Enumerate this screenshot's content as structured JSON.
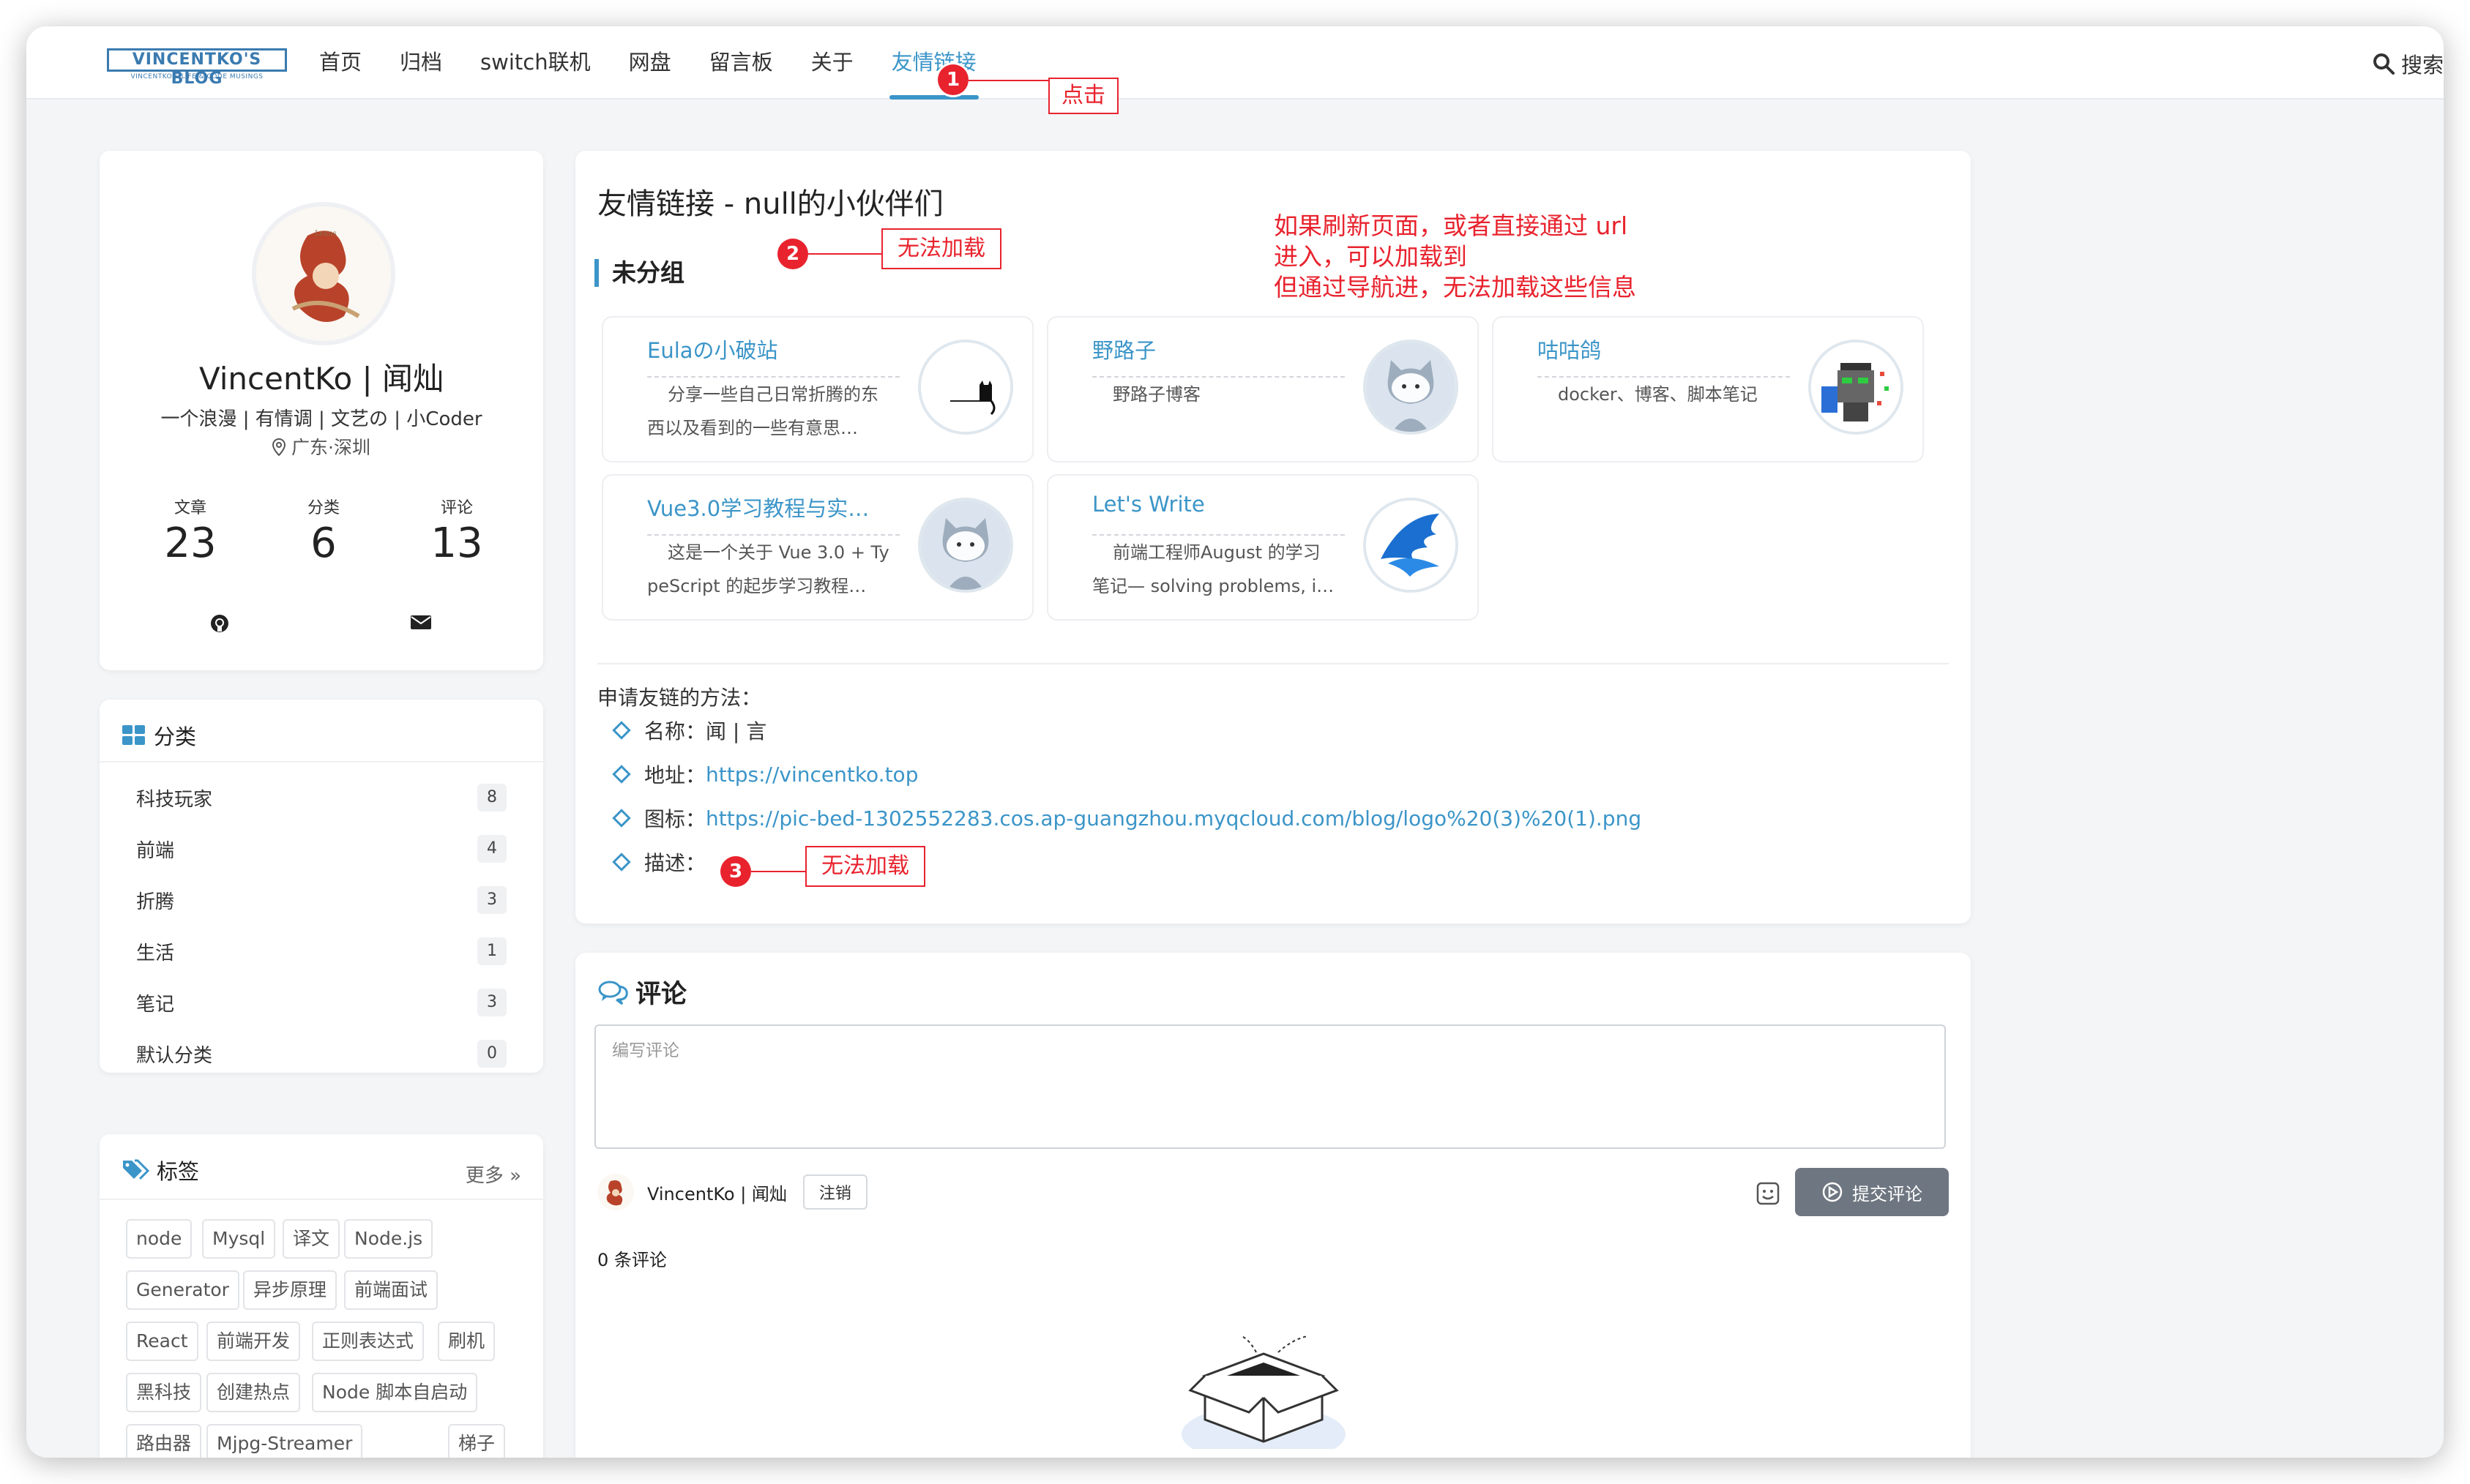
{
  "header": {
    "logo_main": "VINCENTKO'S BLOG",
    "logo_sub": "VINCENTKO'S LIFE & CODE MUSINGS",
    "nav": [
      "首页",
      "归档",
      "switch联机",
      "网盘",
      "留言板",
      "关于",
      "友情链接"
    ],
    "active_nav": "友情链接",
    "search_label": "搜索"
  },
  "annotations": {
    "badge1": "1",
    "badge2": "2",
    "badge3": "3",
    "click_label": "点击",
    "cannot_load_1": "无法加载",
    "cannot_load_2": "无法加载",
    "note_line1": "如果刷新页面，或者直接通过 url",
    "note_line2": "进入，可以加载到",
    "note_line3": "但通过导航进，无法加载这些信息"
  },
  "profile": {
    "name": "VincentKo | 闻灿",
    "motto": "一个浪漫 | 有情调 | 文艺の | 小Coder",
    "location": "广东·深圳",
    "stats": [
      {
        "label": "文章",
        "value": "23"
      },
      {
        "label": "分类",
        "value": "6"
      },
      {
        "label": "评论",
        "value": "13"
      }
    ]
  },
  "categories": {
    "title": "分类",
    "items": [
      {
        "label": "科技玩家",
        "count": "8"
      },
      {
        "label": "前端",
        "count": "4"
      },
      {
        "label": "折腾",
        "count": "3"
      },
      {
        "label": "生活",
        "count": "1"
      },
      {
        "label": "笔记",
        "count": "3"
      },
      {
        "label": "默认分类",
        "count": "0"
      }
    ]
  },
  "tags": {
    "title": "标签",
    "more": "更多",
    "items": [
      "node",
      "Mysql",
      "译文",
      "Node.js",
      "Generator",
      "异步原理",
      "前端面试",
      "React",
      "前端开发",
      "正则表达式",
      "刷机",
      "黑科技",
      "创建热点",
      "Node 脚本自启动",
      "路由器",
      "Mjpg-Streamer",
      "梯子"
    ]
  },
  "main": {
    "title": "友情链接 - null的小伙伴们",
    "group": "未分组",
    "friends": [
      {
        "name": "Eulaの小破站",
        "desc1": "分享一些自己日常折腾的东",
        "desc2": "西以及看到的一些有意思…"
      },
      {
        "name": "野路子",
        "desc1": "野路子博客",
        "desc2": ""
      },
      {
        "name": "咕咕鸽",
        "desc1": "docker、博客、脚本笔记",
        "desc2": ""
      },
      {
        "name": "Vue3.0学习教程与实…",
        "desc1": "这是一个关于 Vue 3.0 + Ty",
        "desc2": "peScript 的起步学习教程…"
      },
      {
        "name": "Let's Write",
        "desc1": "前端工程师August 的学习",
        "desc2": "笔记— solving problems, i…"
      }
    ],
    "apply_title": "申请友链的方法：",
    "apply": [
      {
        "label": "名称：",
        "value": "闻 | 言"
      },
      {
        "label": "地址：",
        "value": "https://vincentko.top"
      },
      {
        "label": "图标：",
        "value": "https://pic-bed-1302552283.cos.ap-guangzhou.myqcloud.com/blog/logo%20(3)%20(1).png"
      },
      {
        "label": "描述：",
        "value": ""
      }
    ]
  },
  "comments": {
    "title": "评论",
    "placeholder": "编写评论",
    "user": "VincentKo | 闻灿",
    "logout": "注销",
    "submit": "提交评论",
    "count": "0 条评论"
  }
}
